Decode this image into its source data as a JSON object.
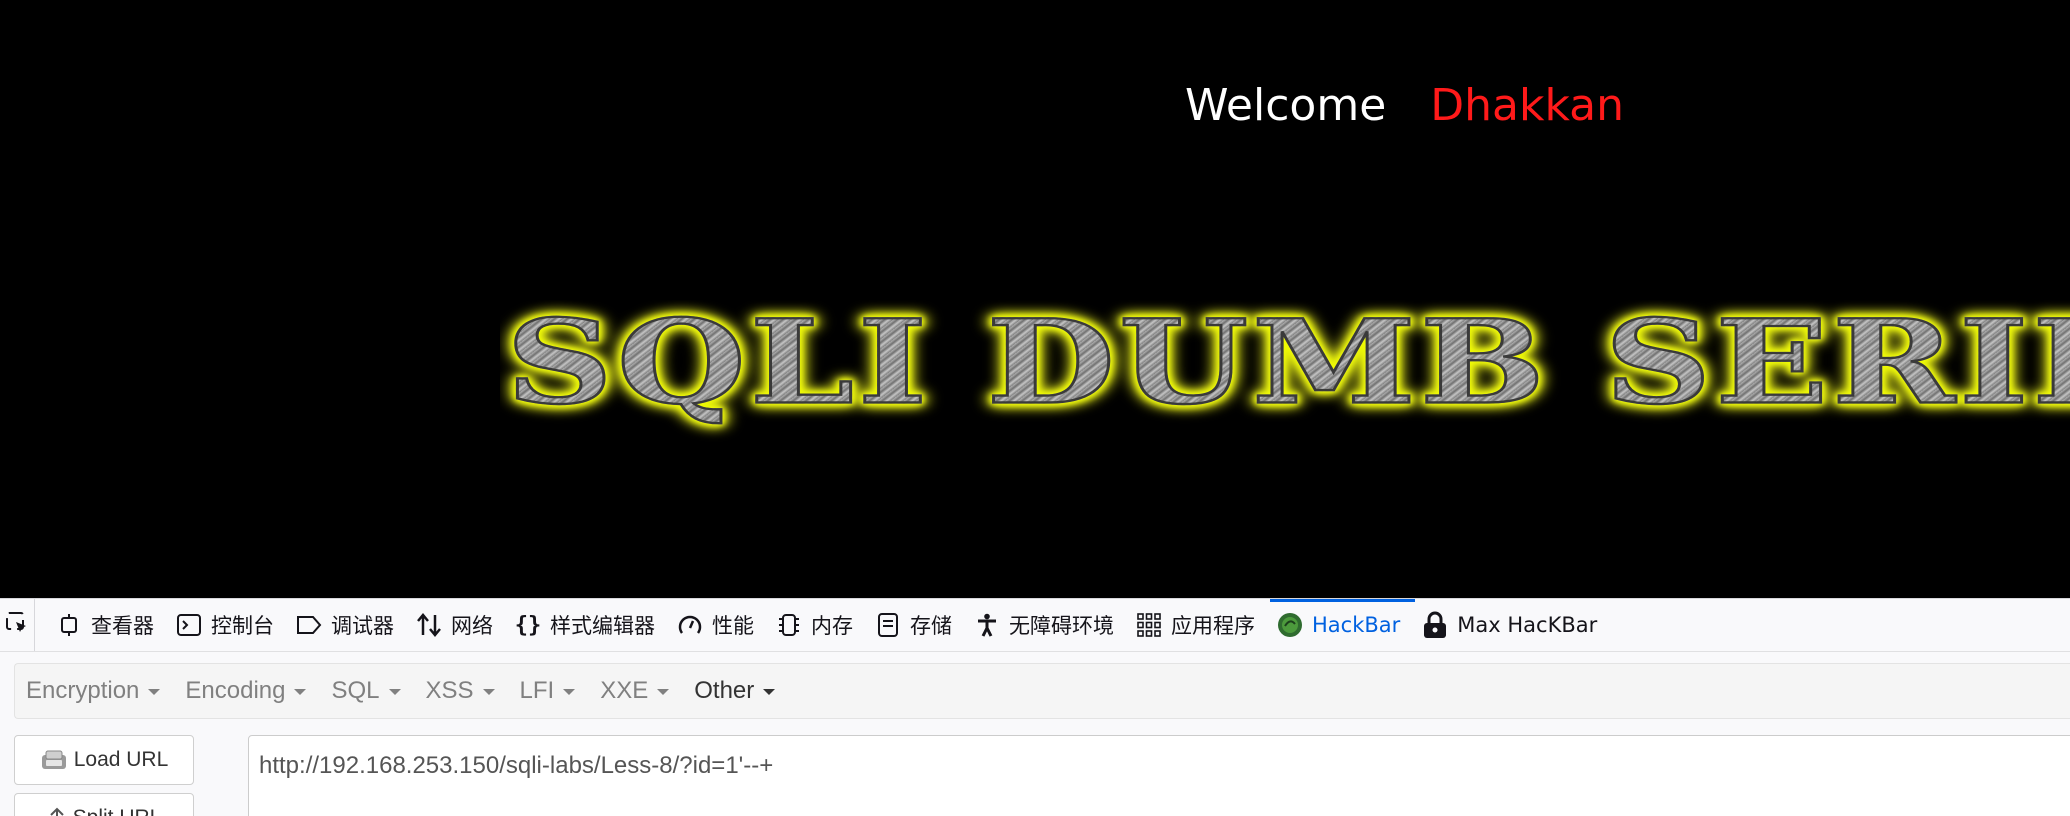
{
  "page": {
    "welcome_text": "Welcome",
    "user_name": "Dhakkan",
    "banner_title": "SQLI DUMB SERIES"
  },
  "devtools": {
    "tabs": [
      {
        "label": "查看器",
        "icon": "inspector-icon"
      },
      {
        "label": "控制台",
        "icon": "console-icon"
      },
      {
        "label": "调试器",
        "icon": "debugger-icon"
      },
      {
        "label": "网络",
        "icon": "network-icon"
      },
      {
        "label": "样式编辑器",
        "icon": "style-editor-icon"
      },
      {
        "label": "性能",
        "icon": "performance-icon"
      },
      {
        "label": "内存",
        "icon": "memory-icon"
      },
      {
        "label": "存储",
        "icon": "storage-icon"
      },
      {
        "label": "无障碍环境",
        "icon": "accessibility-icon"
      },
      {
        "label": "应用程序",
        "icon": "application-icon"
      },
      {
        "label": "HackBar",
        "icon": "hackbar-icon",
        "active": true
      },
      {
        "label": "Max HacKBar",
        "icon": "lock-icon"
      }
    ]
  },
  "hackbar": {
    "menu": [
      "Encryption",
      "Encoding",
      "SQL",
      "XSS",
      "LFI",
      "XXE",
      "Other"
    ],
    "load_url_label": "Load URL",
    "split_url_label": "Split URL",
    "url_value": "http://192.168.253.150/sqli-labs/Less-8/?id=1'--+"
  },
  "colors": {
    "accent": "#0061e0",
    "user_name": "#ff1a1a",
    "banner_glow": "#f2ff00"
  }
}
